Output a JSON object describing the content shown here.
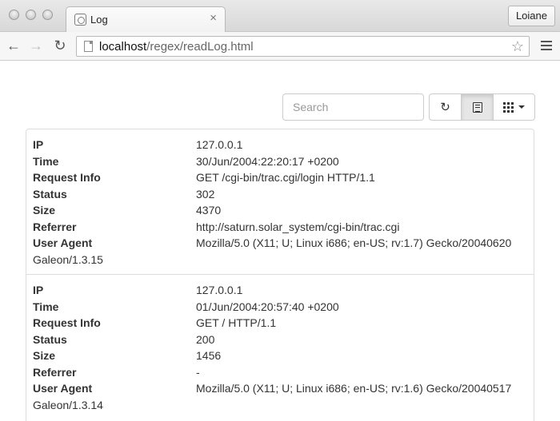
{
  "browser": {
    "tab_title": "Log",
    "tab_close": "×",
    "profile": "Loiane",
    "url_host": "localhost",
    "url_path": "/regex/readLog.html"
  },
  "toolbar": {
    "search_placeholder": "Search"
  },
  "field_labels": {
    "ip": "IP",
    "time": "Time",
    "request": "Request Info",
    "status": "Status",
    "size": "Size",
    "referrer": "Referrer",
    "user_agent": "User Agent"
  },
  "entries": [
    {
      "ip": "127.0.0.1",
      "time": "30/Jun/2004:22:20:17 +0200",
      "request": "GET /cgi-bin/trac.cgi/login HTTP/1.1",
      "status": "302",
      "size": "4370",
      "referrer": "http://saturn.solar_system/cgi-bin/trac.cgi",
      "user_agent": "Mozilla/5.0 (X11; U; Linux i686; en-US; rv:1.7) Gecko/20040620",
      "user_agent_cont": "Galeon/1.3.15"
    },
    {
      "ip": "127.0.0.1",
      "time": "01/Jun/2004:20:57:40 +0200",
      "request": "GET / HTTP/1.1",
      "status": "200",
      "size": "1456",
      "referrer": "-",
      "user_agent": "Mozilla/5.0 (X11; U; Linux i686; en-US; rv:1.6) Gecko/20040517",
      "user_agent_cont": "Galeon/1.3.14"
    }
  ]
}
